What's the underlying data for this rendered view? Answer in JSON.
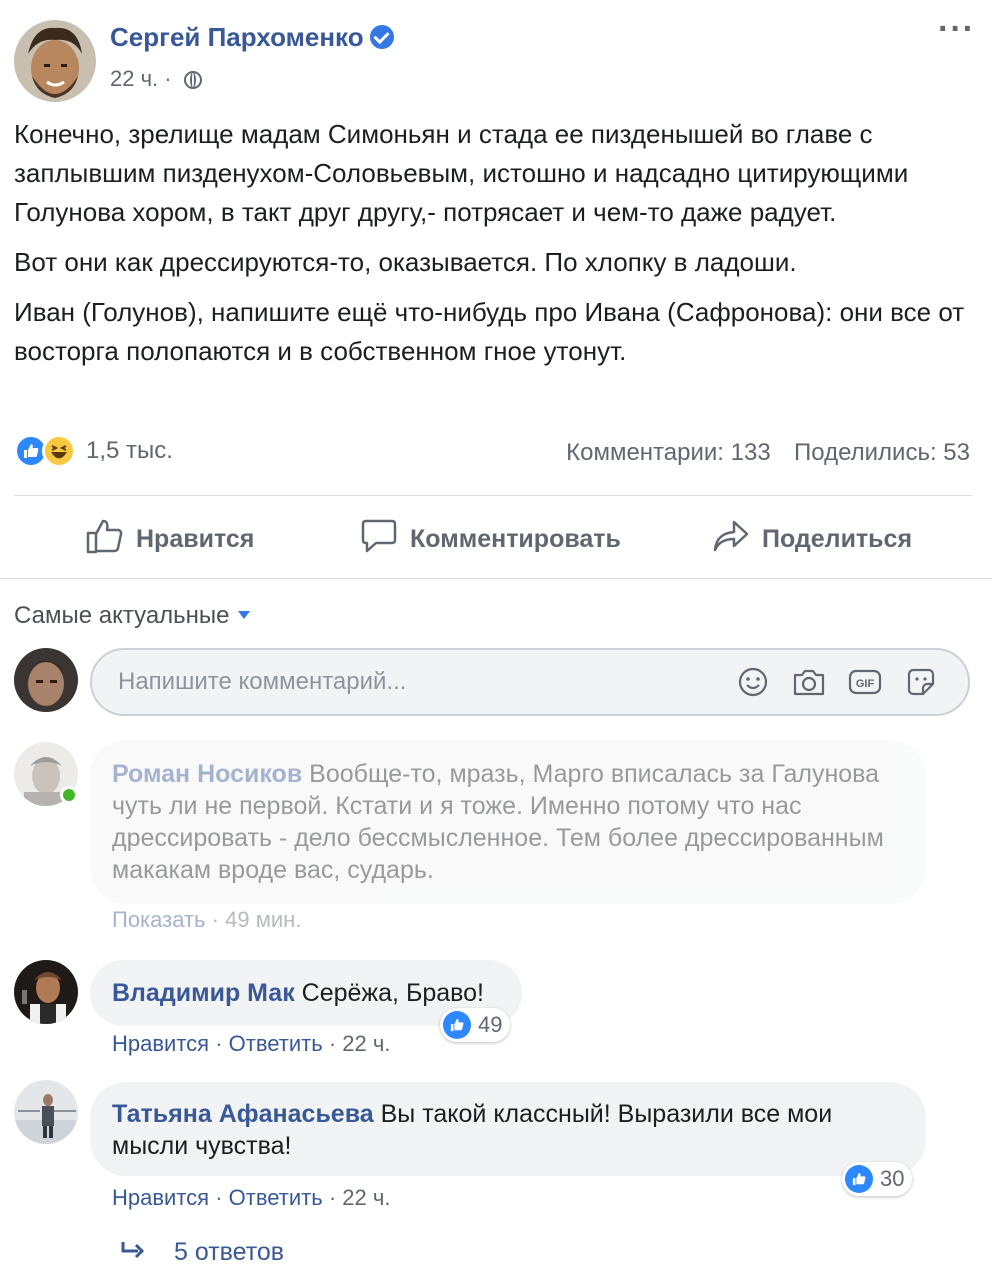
{
  "post": {
    "author": "Сергей Пархоменко",
    "time": "22 ч.",
    "separator": "·",
    "paragraphs": [
      "Конечно, зрелище мадам Симоньян и стада ее пизденышей во главе с заплывшим пизденухом-Соловьевым, истошно и надсадно цитирующими Голунова хором, в такт друг другу,- потрясает и чем-то даже радует.",
      "Вот они как дрессируются-то, оказывается. По хлопку в ладоши.",
      "Иван (Голунов), напишите ещё что-нибудь про Ивана (Сафронова): они все от восторга полопаются и в собственном гное утонут."
    ],
    "reactions_count": "1,5 тыс.",
    "comments_count": "Комментарии: 133",
    "shares_count": "Поделились: 53"
  },
  "actions": {
    "like": "Нравится",
    "comment": "Комментировать",
    "share": "Поделиться"
  },
  "comments_section": {
    "sort_label": "Самые актуальные",
    "input_placeholder": "Напишите комментарий..."
  },
  "comments": [
    {
      "author": "Роман Носиков",
      "text": "Вообще-то, мразь, Марго вписалась за Галунова чуть ли не первой. Кстати и я тоже. Именно потому что нас дрессировать - дело бессмысленное. Тем более дрессированным макакам вроде вас, сударь.",
      "action": "Показать",
      "time": "49 мин."
    },
    {
      "author": "Владимир Мак",
      "text": "Серёжа, Браво!",
      "like": "Нравится",
      "reply": "Ответить",
      "time": "22 ч.",
      "reactions": "49"
    },
    {
      "author": "Татьяна Афанасьева",
      "text": "Вы такой классный! Выразили все мои мысли чувства!",
      "like": "Нравится",
      "reply": "Ответить",
      "time": "22 ч.",
      "reactions": "30"
    }
  ],
  "replies_label": "5 ответов",
  "colors": {
    "link": "#385898",
    "accent": "#2d88ff",
    "muted": "#606770",
    "bubble": "#f2f3f5"
  }
}
